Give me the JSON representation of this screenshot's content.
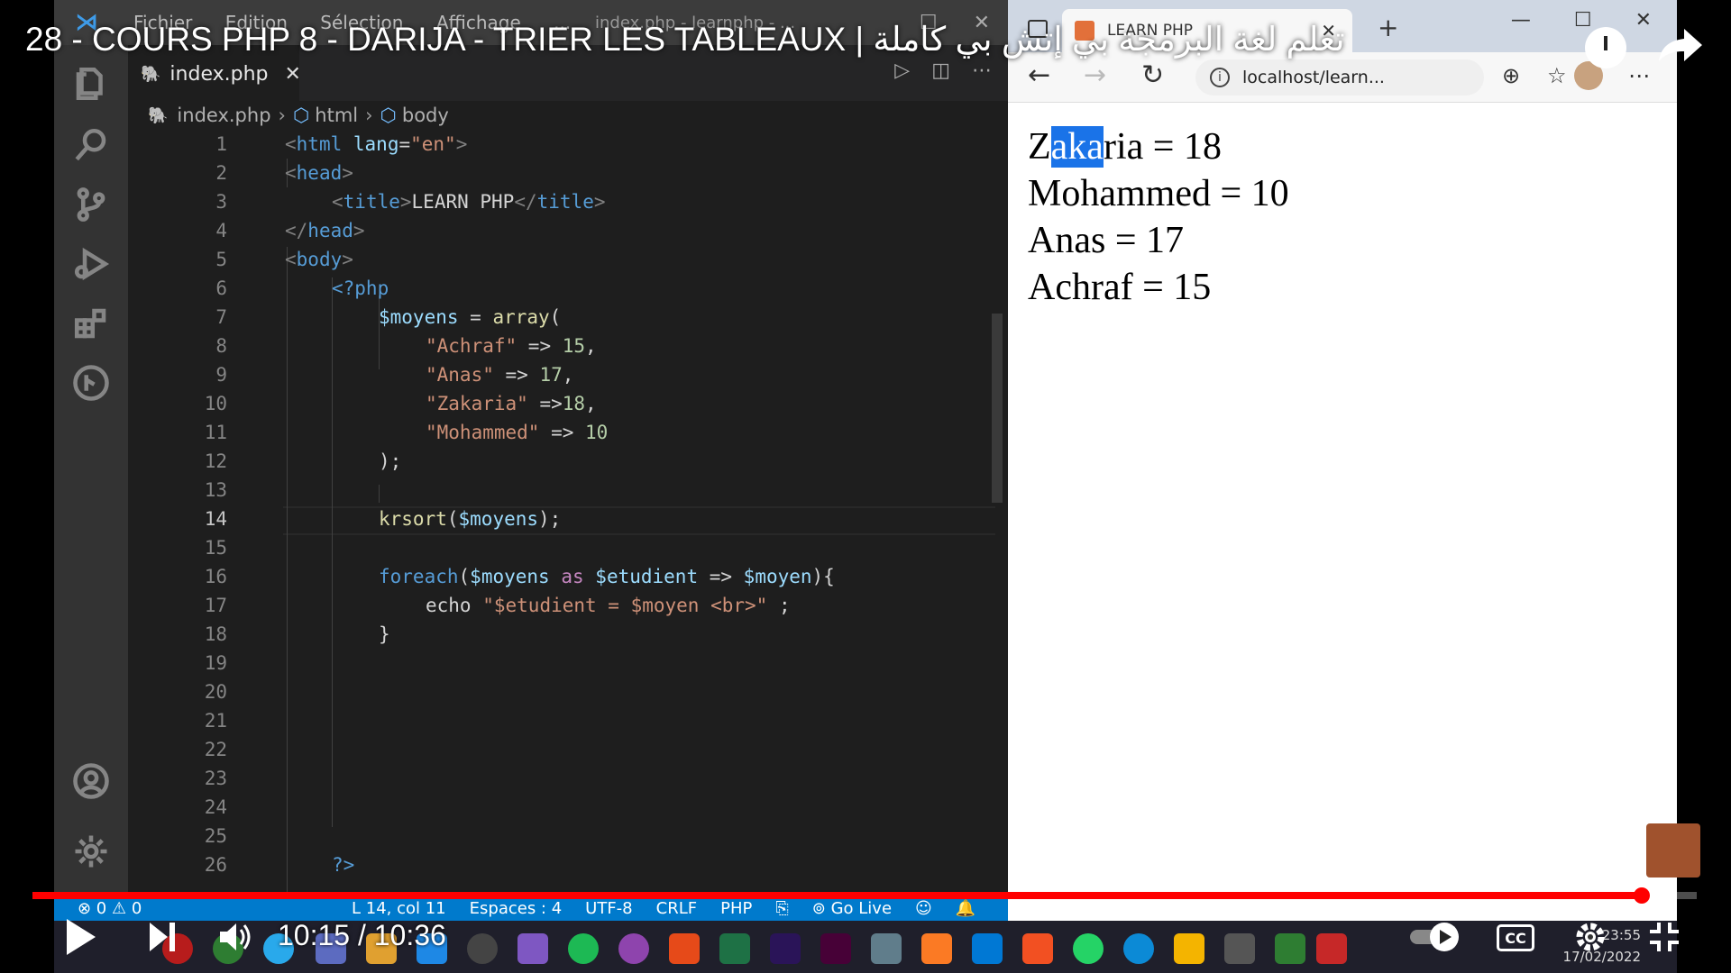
{
  "video": {
    "title": "28 - COURS PHP 8 - DARIJA - TRIER LES TABLEAUX | تعلم لغة البرمجة بي إتش بي كاملة",
    "current_time": "10:15",
    "duration": "10:36",
    "time_display": "10:15 / 10:36",
    "progress_fraction": 0.967
  },
  "vscode": {
    "menu": [
      "Fichier",
      "Edition",
      "Sélection",
      "Affichage",
      "..."
    ],
    "window_title": "index.php - learnphp - ...",
    "tab_label": "index.php",
    "breadcrumb": [
      "index.php",
      "html",
      "body"
    ],
    "active_line": 14,
    "line_numbers": [
      "1",
      "2",
      "3",
      "4",
      "5",
      "6",
      "7",
      "8",
      "9",
      "10",
      "11",
      "12",
      "13",
      "14",
      "15",
      "16",
      "17",
      "18",
      "19",
      "20",
      "21",
      "22",
      "23",
      "24",
      "25",
      "26"
    ],
    "code_text": {
      "html_lang_val": "\"en\"",
      "title_text": "LEARN PHP",
      "moyens_var": "$moyens",
      "array_fn": "array",
      "k1": "\"Achraf\"",
      "v1": "15",
      "k2": "\"Anas\"",
      "v2": "17",
      "k3": "\"Zakaria\"",
      "v3": "18",
      "k4": "\"Mohammed\"",
      "v4": "10",
      "krsort": "krsort",
      "foreach": "foreach",
      "as": "as",
      "etudient": "$etudient",
      "moyen": "$moyen",
      "echo": "echo",
      "echo_str": "\"$etudient = $moyen <br>\""
    },
    "status": {
      "problems": "⊗ 0 ⚠ 0",
      "position": "L 14, col 11",
      "spaces": "Espaces : 4",
      "encoding": "UTF-8",
      "eol": "CRLF",
      "language": "PHP",
      "golive": "Go Live"
    }
  },
  "browser": {
    "tab_title": "LEARN PHP",
    "url": "localhost/learn...",
    "output_lines": [
      {
        "name": "Zakaria",
        "value": "18"
      },
      {
        "name": "Mohammed",
        "value": "10"
      },
      {
        "name": "Anas",
        "value": "17"
      },
      {
        "name": "Achraf",
        "value": "15"
      }
    ]
  },
  "taskbar": {
    "time": "23:55",
    "date": "17/02/2022"
  },
  "colors": {
    "progress": "#ff0000",
    "vscode_status": "#007acc",
    "selection": "#1a73e8"
  }
}
